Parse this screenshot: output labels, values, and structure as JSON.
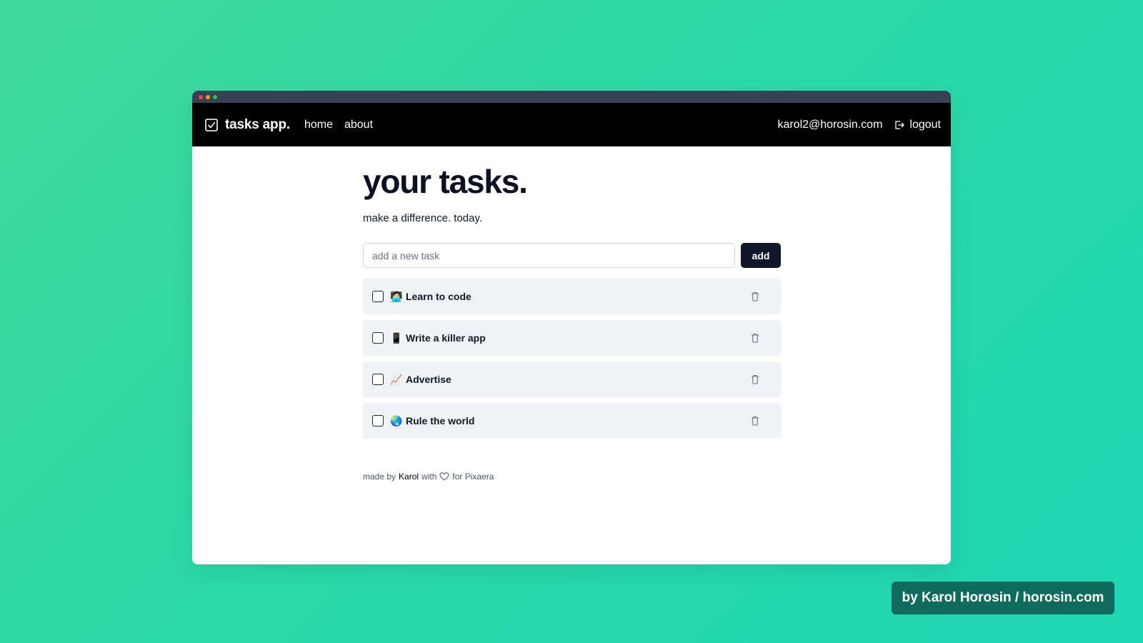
{
  "window": {
    "controls": [
      {
        "name": "close",
        "color": "#ef4444"
      },
      {
        "name": "minimize",
        "color": "#f59e0b"
      },
      {
        "name": "zoom",
        "color": "#22c55e"
      }
    ]
  },
  "navbar": {
    "brand": "tasks app.",
    "brand_icon": "checkbox-icon",
    "links": [
      "home",
      "about"
    ],
    "user_email": "karol2@horosin.com",
    "logout_label": "logout",
    "logout_icon": "logout-icon"
  },
  "main": {
    "title": "your tasks.",
    "subtitle": "make a difference. today.",
    "input_placeholder": "add a new task",
    "add_label": "add",
    "tasks": [
      {
        "emoji": "🧑🏻‍💻",
        "text": "Learn to code",
        "done": false
      },
      {
        "emoji": "📱",
        "text": "Write a killer app",
        "done": false
      },
      {
        "emoji": "📈",
        "text": "Advertise",
        "done": false
      },
      {
        "emoji": "🌏",
        "text": "Rule the world",
        "done": false
      }
    ]
  },
  "footer": {
    "made_by": "made by",
    "author": "Karol",
    "with": "with",
    "for_text": "for Pixaera"
  },
  "credit": "by Karol Horosin / horosin.com",
  "colors": {
    "background_start": "#3fd99a",
    "background_end": "#1dd6b2",
    "navbar": "#000000",
    "titlebar": "#374151",
    "add_button": "#0f172a",
    "task_bg": "#eff2f7",
    "credit_bg": "#0f6b5c"
  }
}
